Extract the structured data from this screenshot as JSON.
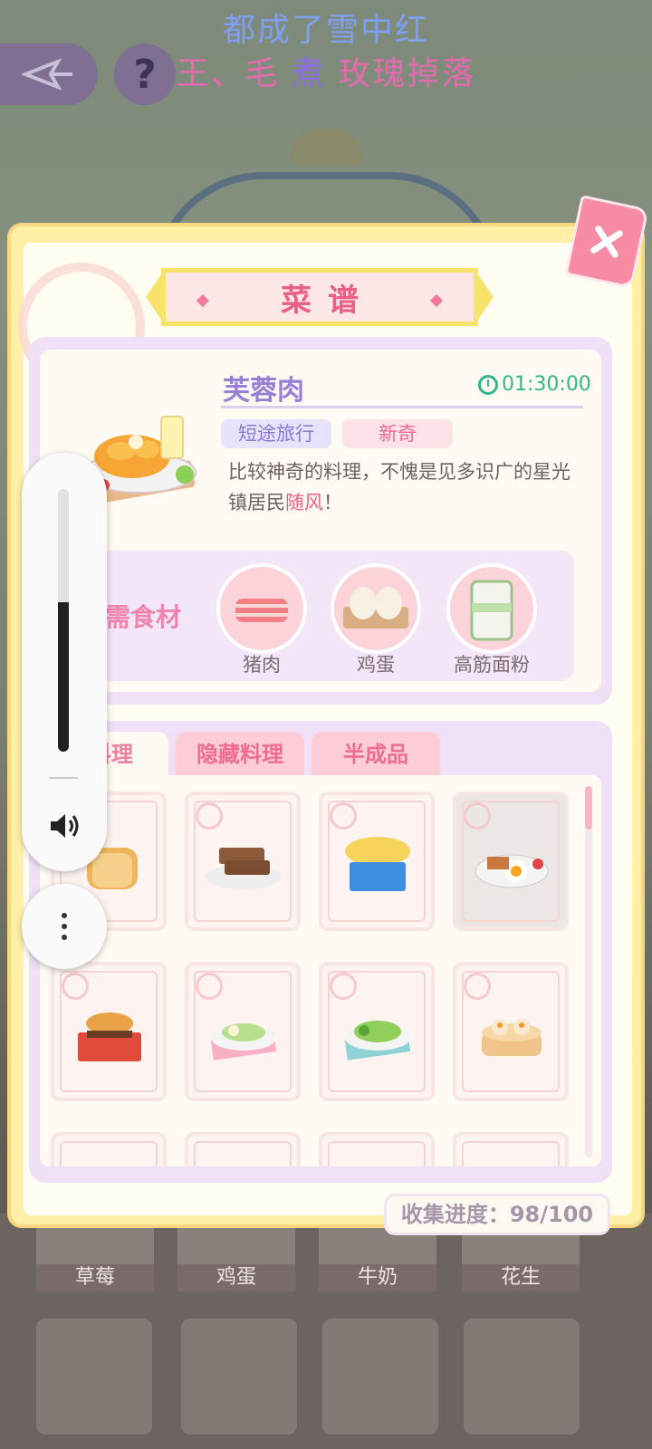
{
  "background": {
    "lyric_line1": "都成了雪中红",
    "lyric_line2_a": "王、毛",
    "lyric_line2_b": "煮",
    "lyric_line2_c": "玫瑰掉落",
    "bottom_items": [
      "草莓",
      "鸡蛋",
      "牛奶",
      "花生"
    ]
  },
  "toolbar": {
    "back_icon": "compass-arrow-icon",
    "help_label": "?"
  },
  "modal": {
    "title": "菜谱",
    "close_icon": "close-icon",
    "dish": {
      "name": "芙蓉肉",
      "timer": "01:30:00",
      "tags": [
        "短途旅行",
        "新奇"
      ],
      "description_a": "比较神奇的料理，不愧是见多识广的星光镇居民",
      "description_highlight": "随风",
      "description_b": "！"
    },
    "ingredients": {
      "label": "所需食材",
      "items": [
        {
          "name": "猪肉",
          "icon": "pork-icon"
        },
        {
          "name": "鸡蛋",
          "icon": "egg-carton-icon"
        },
        {
          "name": "高筋面粉",
          "icon": "flour-bag-icon"
        }
      ]
    },
    "tabs": [
      "料理",
      "隐藏料理",
      "半成品"
    ],
    "active_tab": "料理",
    "dishes": [
      "bread-icon",
      "toast-icon",
      "sandwich-box-icon",
      "breakfast-plate-icon",
      "burger-box-icon",
      "salad-plate-icon",
      "green-salad-icon",
      "dim-sum-steamer-icon"
    ],
    "progress": "收集进度：98/100"
  },
  "volume_overlay": {
    "level_percent": 57,
    "speaker_icon": "speaker-icon",
    "more_icon": "more-vertical-icon"
  },
  "colors": {
    "accent_pink": "#ef5f84",
    "accent_purple": "#9880d4",
    "timer_green": "#33b58b",
    "frame_yellow": "#f7d880"
  }
}
